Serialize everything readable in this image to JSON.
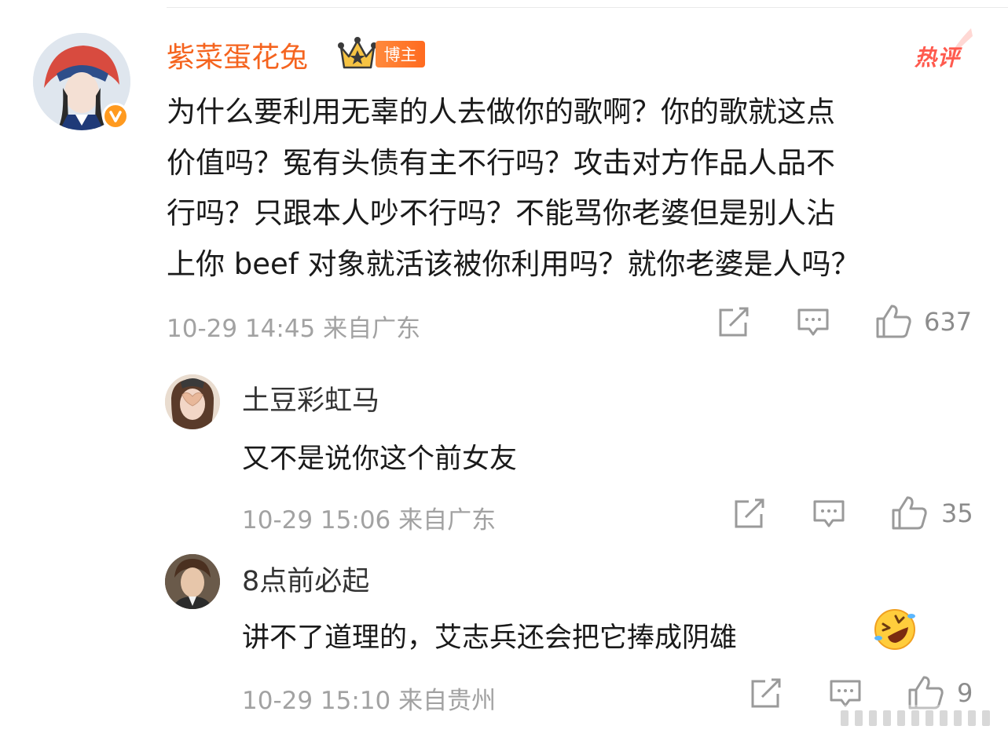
{
  "main_comment": {
    "username": "紫菜蛋花兔",
    "badge": "博主",
    "hot_label": "热评",
    "text_lines": [
      "为什么要利用无辜的人去做你的歌啊？你的歌就这点",
      "价值吗？冤有头债有主不行吗？攻击对方作品人品不",
      "行吗？只跟本人吵不行吗？不能骂你老婆但是别人沾",
      "上你 beef 对象就活该被你利用吗？就你老婆是人吗？"
    ],
    "meta": "10-29 14:45 来自广东",
    "like_count": "637"
  },
  "replies": [
    {
      "username": "土豆彩虹马",
      "text": "又不是说你这个前女友",
      "meta": "10-29 15:06 来自广东",
      "like_count": "35"
    },
    {
      "username": "8点前必起",
      "text": "讲不了道理的，艾志兵还会把它捧成阴雄",
      "meta": "10-29 15:10 来自贵州",
      "like_count": "9"
    }
  ],
  "colors": {
    "username_vip": "#f5641f",
    "badge_bg": "#ff7a2e",
    "hot": "#ff5a4e",
    "meta": "#a2a2a2",
    "icon": "#9a9a9a"
  }
}
